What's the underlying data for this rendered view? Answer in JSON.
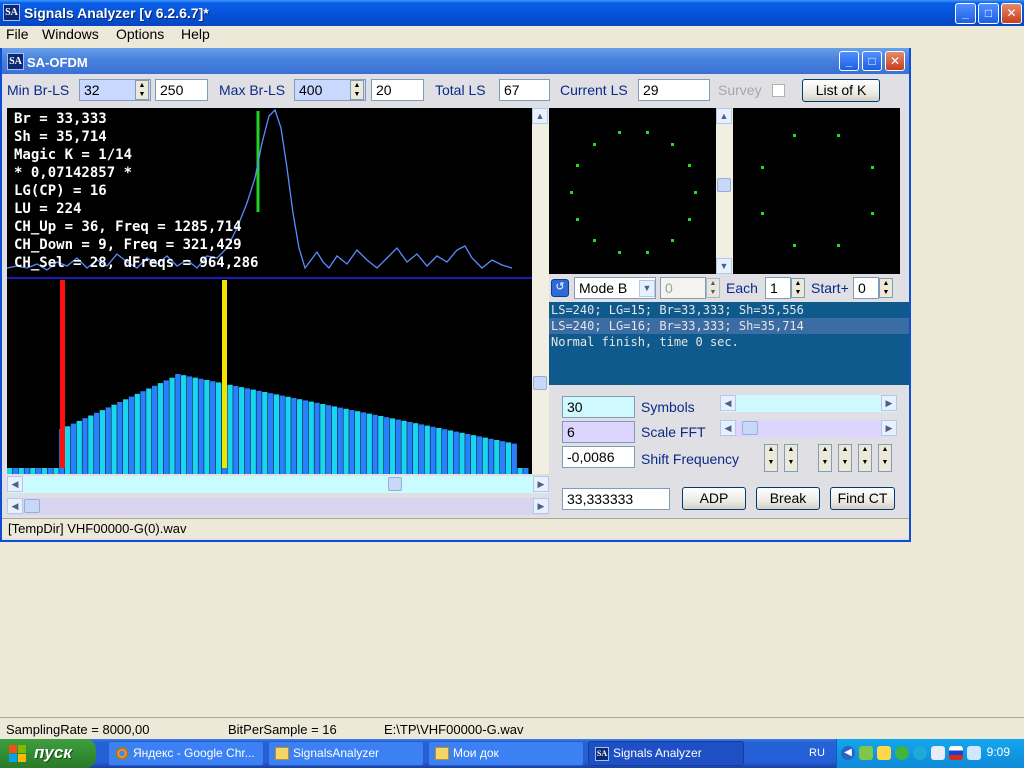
{
  "app": {
    "title": "Signals Analyzer [v 6.2.6.7]*",
    "icon_text": "SA"
  },
  "menu": [
    "File",
    "Windows",
    "Options",
    "Help"
  ],
  "child": {
    "title": "SA-OFDM",
    "toolbar": {
      "min_br_ls_label": "Min Br-LS",
      "min_br_ls_value": "32",
      "min_br_ls_step": "250",
      "max_br_ls_label": "Max Br-LS",
      "max_br_ls_value": "400",
      "max_br_ls_step": "20",
      "total_ls_label": "Total LS",
      "total_ls_value": "67",
      "current_ls_label": "Current LS",
      "current_ls_value": "29",
      "survey_label": "Survey",
      "list_of_k_label": "List of K"
    },
    "readout": [
      "Br = 33,333",
      "Sh = 35,714",
      "Magic K = 1/14",
      "* 0,07142857 *",
      "LG(CP) = 16",
      "LU = 224",
      "CH_Up = 36, Freq = 1285,714",
      "CH_Down = 9, Freq = 321,429",
      "CH_Sel = 28, dFreqs = 964,286"
    ],
    "mode_bar": {
      "mode_value": "Mode B",
      "num_value": "0",
      "each_label": "Each",
      "each_value": "1",
      "start_label": "Start+",
      "start_value": "0"
    },
    "log": [
      "LS=240; LG=15; Br=33,333; Sh=35,556",
      "LS=240; LG=16; Br=33,333; Sh=35,714",
      "Normal finish, time 0 sec."
    ],
    "controls": {
      "symbols_value": "30",
      "symbols_label": "Symbols",
      "scale_fft_value": "6",
      "scale_fft_label": "Scale FFT",
      "shift_freq_value": "-0,0086",
      "shift_freq_label": "Shift Frequency",
      "br_value": "33,333333",
      "adp_label": "ADP",
      "break_label": "Break",
      "find_ct_label": "Find CT"
    },
    "status": "[TempDir] VHF00000-G(0).wav"
  },
  "statusbar": {
    "sampling_rate": "SamplingRate = 8000,00",
    "bps": "BitPerSample = 16",
    "file": "E:\\TP\\VHF00000-G.wav"
  },
  "taskbar": {
    "start_label": "пуск",
    "tasks": [
      "Яндекс - Google Chr...",
      "SignalsAnalyzer",
      "Мои док",
      "Signals Analyzer"
    ],
    "lang": "RU",
    "clock": "9:09"
  },
  "colors": {
    "spectrum_blue": "#2a7fff",
    "spectrum_cyan": "#19d6f0",
    "marker_red": "#ff1010",
    "marker_yellow": "#f2e400",
    "marker_green": "#22d222",
    "constellation": "#22dd22",
    "autocorr_line": "#5a8cff"
  }
}
